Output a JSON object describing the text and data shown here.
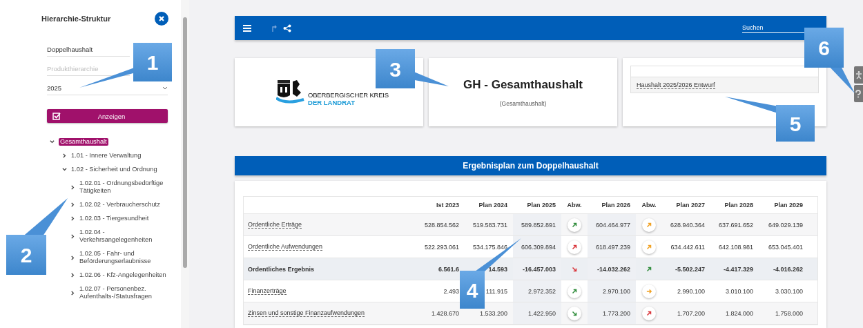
{
  "sidebar": {
    "title": "Hierarchie-Struktur",
    "fields": [
      {
        "value": "Doppelhaushalt",
        "kind": "text"
      },
      {
        "placeholder": "Produkthierarchie",
        "kind": "text"
      },
      {
        "value": "2025",
        "kind": "select"
      }
    ],
    "button": "Anzeigen",
    "tree": [
      {
        "label": "Gesamthaushalt",
        "selected": true,
        "expanded": true,
        "children": [
          {
            "label": "1.01 - Innere Verwaltung",
            "selected": false,
            "expanded": false
          },
          {
            "label": "1.02 - Sicherheit und Ordnung",
            "selected": false,
            "expanded": true,
            "children": [
              {
                "label": "1.02.01 - Ordnungsbedürftige Tätigkeiten",
                "selected": false,
                "expanded": false
              },
              {
                "label": "1.02.02 - Verbraucherschutz",
                "selected": false,
                "expanded": false
              },
              {
                "label": "1.02.03 - Tiergesundheit",
                "selected": false,
                "expanded": false
              },
              {
                "label": "1.02.04 - Verkehrsangelegenheiten",
                "selected": false,
                "expanded": false
              },
              {
                "label": "1.02.05 - Fahr- und Beförderungserlaubnisse",
                "selected": false,
                "expanded": false
              },
              {
                "label": "1.02.06 - Kfz-Angelegenheiten",
                "selected": false,
                "expanded": false
              },
              {
                "label": "1.02.07 - Personenbez. Aufenthalts-/Statusfragen",
                "selected": false,
                "expanded": false
              }
            ]
          }
        ]
      }
    ]
  },
  "toolbar": {
    "search_placeholder": "Suchen"
  },
  "logo": {
    "line1": "OBERBERGISCHER KREIS",
    "line2": "DER LANDRAT"
  },
  "heading": {
    "title": "GH - Gesamthaushalt",
    "subtitle": "(Gesamthaushalt)"
  },
  "version_list": {
    "items": [
      "Haushalt 2025/2026 Entwurf"
    ]
  },
  "section_title": "Ergebnisplan zum Doppelhaushalt",
  "table": {
    "columns": [
      {
        "kind": "label"
      },
      {
        "label": "Ist 2023",
        "kind": "num"
      },
      {
        "label": "Plan 2024",
        "kind": "num"
      },
      {
        "label": "Plan 2025",
        "kind": "hl"
      },
      {
        "label": "Abw.",
        "kind": "abw"
      },
      {
        "label": "Plan 2026",
        "kind": "hl"
      },
      {
        "label": "Abw.",
        "kind": "abw"
      },
      {
        "label": "Plan 2027",
        "kind": "num"
      },
      {
        "label": "Plan 2028",
        "kind": "num"
      },
      {
        "label": "Plan 2029",
        "kind": "num"
      }
    ],
    "rows": [
      {
        "kind": "link",
        "label": "Ordentliche Erträge",
        "values": [
          "528.854.562",
          "519.583.731",
          "589.852.891",
          {
            "kind": "up",
            "color": "#2e8b3a",
            "button": true
          },
          "604.464.977",
          {
            "kind": "up",
            "color": "#f0a020",
            "button": true
          },
          "628.940.364",
          "637.691.652",
          "649.029.139"
        ]
      },
      {
        "kind": "link",
        "label": "Ordentliche Aufwendungen",
        "values": [
          "522.293.061",
          "534.175.846",
          "606.309.894",
          {
            "kind": "up",
            "color": "#d9343a",
            "button": true
          },
          "618.497.239",
          {
            "kind": "up",
            "color": "#f0a020",
            "button": true
          },
          "634.442.611",
          "642.108.981",
          "653.045.401"
        ]
      },
      {
        "kind": "total",
        "label": "Ordentliches Ergebnis",
        "values": [
          "6.561.6",
          "14.593",
          "-16.457.003",
          {
            "kind": "down",
            "color": "#d9343a",
            "button": false
          },
          "-14.032.262",
          {
            "kind": "up",
            "color": "#2e8b3a",
            "button": false
          },
          "-5.502.247",
          "-4.417.329",
          "-4.016.262"
        ]
      },
      {
        "kind": "link",
        "label": "Finanzerträge",
        "values": [
          "2.493",
          "111.915",
          "2.972.352",
          {
            "kind": "up",
            "color": "#2e8b3a",
            "button": true
          },
          "2.970.100",
          {
            "kind": "right",
            "color": "#f0a020",
            "button": true
          },
          "2.990.100",
          "3.010.100",
          "3.030.100"
        ]
      },
      {
        "kind": "link",
        "label": "Zinsen und sonstige Finanzaufwendungen",
        "values": [
          "1.428.670",
          "1.533.200",
          "1.422.950",
          {
            "kind": "down",
            "color": "#2e8b3a",
            "button": true
          },
          "1.773.200",
          {
            "kind": "up",
            "color": "#d9343a",
            "button": true
          },
          "1.707.200",
          "1.824.000",
          "1.758.000"
        ]
      }
    ]
  },
  "callouts": [
    {
      "number": "1"
    },
    {
      "number": "2"
    },
    {
      "number": "3"
    },
    {
      "number": "4"
    },
    {
      "number": "5"
    },
    {
      "number": "6"
    }
  ]
}
